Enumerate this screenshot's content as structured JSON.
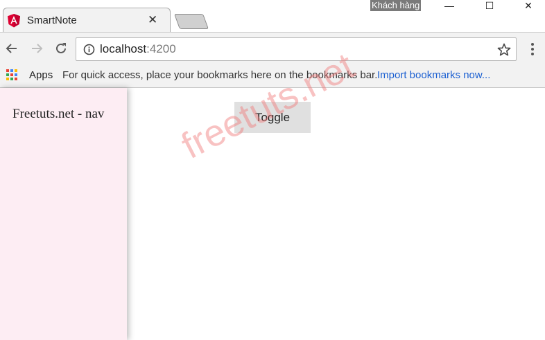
{
  "browser": {
    "tab": {
      "title": "SmartNote",
      "favicon": "angular-icon",
      "close_label": "✕"
    },
    "user_label": "Khách hàng",
    "window_controls": {
      "minimize": "—",
      "maximize": "☐",
      "close": "✕"
    },
    "address": {
      "host": "localhost",
      "port": ":4200"
    },
    "bookmarks_bar": {
      "apps_label": "Apps",
      "hint": "For quick access, place your bookmarks here on the bookmarks bar.",
      "import_link": "Import bookmarks now..."
    }
  },
  "page": {
    "sidenav_text": "Freetuts.net - nav",
    "toggle_label": "Toggle",
    "watermark": "freetuts.net"
  },
  "colors": {
    "sidenav_bg": "#fdedf3",
    "toggle_bg": "#e0e0e0",
    "link": "#1a5fd1",
    "angular_red": "#dd0031"
  }
}
